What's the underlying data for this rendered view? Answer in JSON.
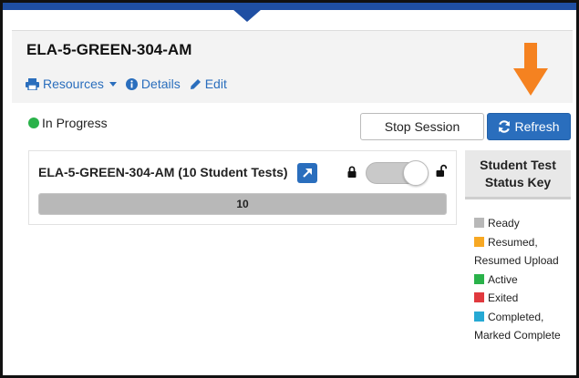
{
  "session": {
    "title": "ELA-5-GREEN-304-AM",
    "status": "In Progress",
    "status_color": "#2ab24a"
  },
  "actions": {
    "resources": "Resources",
    "details": "Details",
    "edit": "Edit"
  },
  "buttons": {
    "stop_session": "Stop Session",
    "refresh": "Refresh"
  },
  "test_card": {
    "title": "ELA-5-GREEN-304-AM (10 Student Tests)",
    "progress_label": "10",
    "progress_fraction": 1.0
  },
  "status_key": {
    "title": "Student Test Status Key",
    "items": [
      {
        "label": "Ready",
        "color": "#b8b8b8"
      },
      {
        "label": "Resumed, Resumed Upload",
        "color": "#f7a823"
      },
      {
        "label": "Active",
        "color": "#2ab24a"
      },
      {
        "label": "Exited",
        "color": "#e0393e"
      },
      {
        "label": "Completed, Marked Complete",
        "color": "#26a9d4"
      }
    ]
  },
  "colors": {
    "brand_blue": "#2a6ebd",
    "top_bar": "#1f4fa3",
    "annotation_arrow": "#f58220"
  }
}
